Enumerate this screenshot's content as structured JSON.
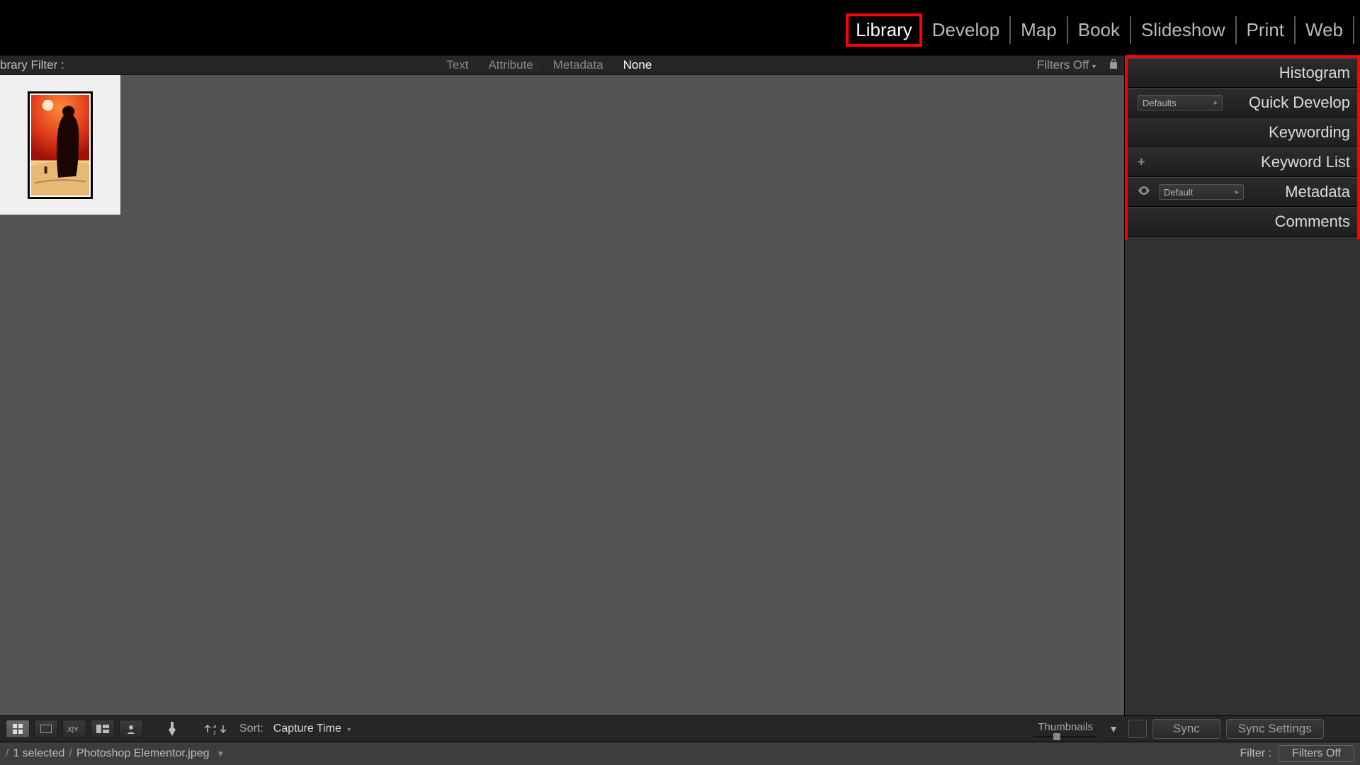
{
  "modules": {
    "items": [
      "Library",
      "Develop",
      "Map",
      "Book",
      "Slideshow",
      "Print",
      "Web"
    ],
    "active": "Library"
  },
  "filter_bar": {
    "label": "brary Filter :",
    "tabs": {
      "text": "Text",
      "attribute": "Attribute",
      "metadata": "Metadata",
      "none": "None"
    },
    "active_tab": "None",
    "filters_off": "Filters Off"
  },
  "thumbnail": {
    "alt": "desert-figure-thumbnail"
  },
  "right_panel": {
    "histogram": "Histogram",
    "quick_develop": "Quick Develop",
    "quick_develop_preset": "Defaults",
    "keywording": "Keywording",
    "keyword_list": "Keyword List",
    "metadata": "Metadata",
    "metadata_preset": "Default",
    "comments": "Comments"
  },
  "toolbar": {
    "sort_label": "Sort:",
    "sort_value": "Capture Time",
    "thumbnail_label": "Thumbnails"
  },
  "status": {
    "selected": "1 selected",
    "filename": "Photoshop Elementor.jpeg"
  },
  "right_bottom": {
    "sync": "Sync",
    "sync_settings": "Sync Settings"
  },
  "right_status": {
    "filter_label": "Filter :",
    "filters_off": "Filters Off"
  }
}
